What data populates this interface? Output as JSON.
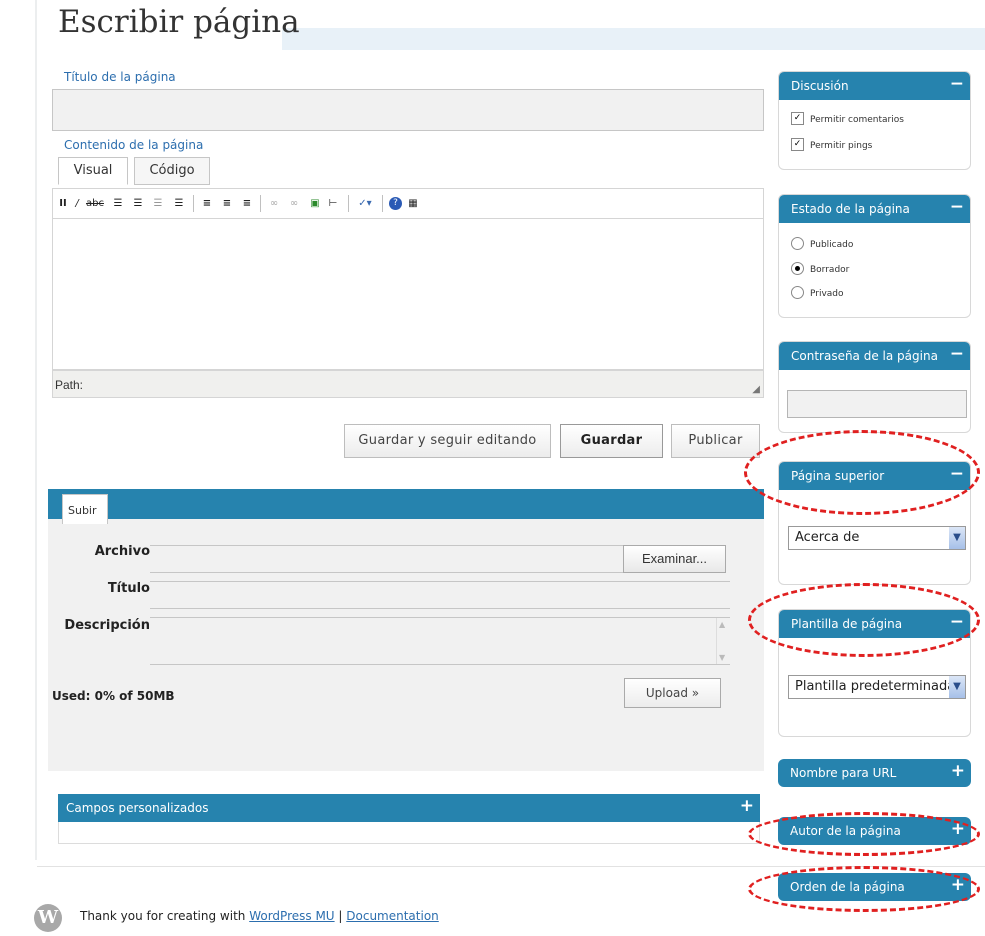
{
  "page": {
    "title": "Escribir página"
  },
  "title_field": {
    "label": "Título de la página",
    "value": ""
  },
  "content_field": {
    "label": "Contenido de la página"
  },
  "editor_tabs": [
    {
      "label": "Visual"
    },
    {
      "label": "Código"
    }
  ],
  "editor": {
    "toolbar_icons": [
      "bold-icon",
      "italic-icon",
      "strikethrough-icon",
      "bullet-list-icon",
      "numbered-list-icon",
      "outdent-icon",
      "indent-icon",
      "align-left-icon",
      "align-center-icon",
      "align-right-icon",
      "link-icon",
      "unlink-icon",
      "insert-image-icon",
      "more-tag-icon",
      "spellcheck-icon",
      "help-icon",
      "kitchen-sink-icon"
    ],
    "path_label": "Path:"
  },
  "actions": {
    "save_continue": "Guardar y seguir editando",
    "save": "Guardar",
    "publish": "Publicar"
  },
  "upload": {
    "tab": "Subir",
    "file_label": "Archivo",
    "browse_button": "Examinar...",
    "title_label": "Título",
    "description_label": "Descripción",
    "used": "Used: 0% of 50MB",
    "upload_button": "Upload »"
  },
  "custom_fields": {
    "title": "Campos personalizados",
    "toggle": "+"
  },
  "footer": {
    "thank_you": "Thank you for creating with ",
    "wpmu_link": "WordPress MU",
    "separator": " | ",
    "doc_link": "Documentation"
  },
  "sidebar": {
    "discussion": {
      "title": "Discusión",
      "toggle": "−",
      "allow_comments": "Permitir comentarios",
      "allow_pings": "Permitir pings"
    },
    "status": {
      "title": "Estado de la página",
      "toggle": "−",
      "published": "Publicado",
      "draft": "Borrador",
      "private": "Privado",
      "selected": "Borrador"
    },
    "password": {
      "title": "Contraseña de la página",
      "toggle": "−",
      "value": ""
    },
    "parent": {
      "title": "Página superior",
      "toggle": "−",
      "selected": "Acerca de"
    },
    "template": {
      "title": "Plantilla de página",
      "toggle": "−",
      "selected": "Plantilla predeterminada"
    },
    "slug": {
      "title": "Nombre para URL",
      "toggle": "+"
    },
    "author": {
      "title": "Autor de la página",
      "toggle": "+"
    },
    "order": {
      "title": "Orden de la página",
      "toggle": "+"
    }
  },
  "colors": {
    "accent": "#2683ae",
    "link": "#2c6eae",
    "highlight": "#e02020"
  }
}
